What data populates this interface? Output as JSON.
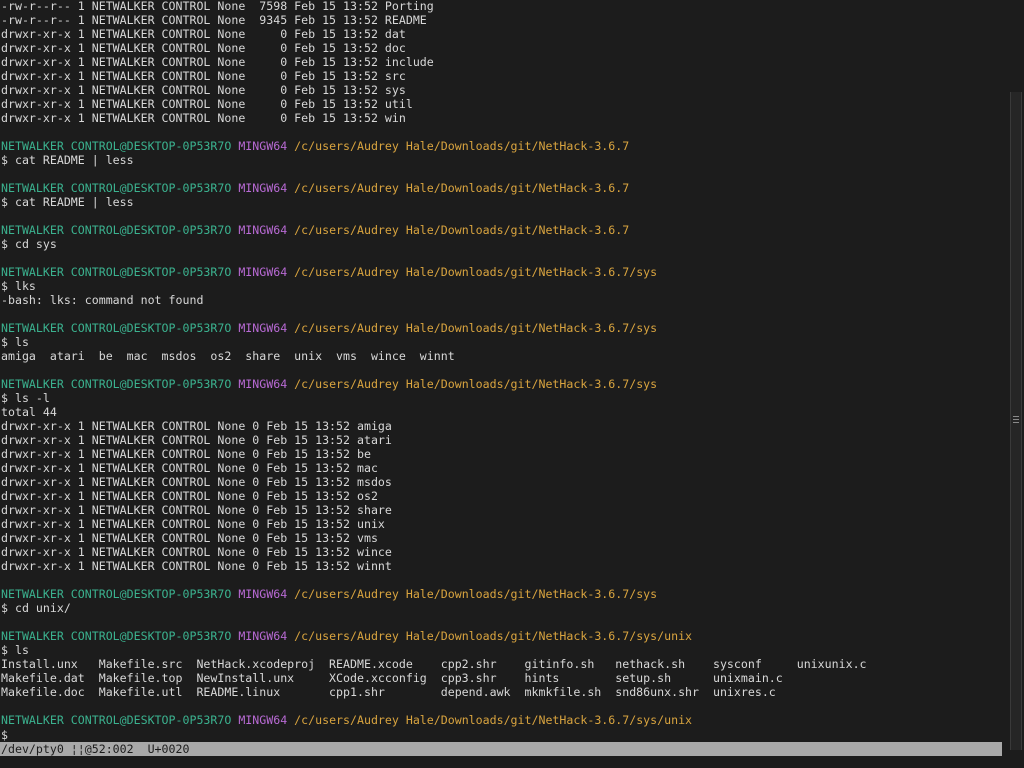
{
  "terminal": {
    "lines": [
      [
        {
          "t": "-rw-r--r-- 1 NETWALKER CONTROL None  7598 Feb 15 13:52 Porting",
          "c": "plain"
        }
      ],
      [
        {
          "t": "-rw-r--r-- 1 NETWALKER CONTROL None  9345 Feb 15 13:52 README",
          "c": "plain"
        }
      ],
      [
        {
          "t": "drwxr-xr-x 1 NETWALKER CONTROL None     0 Feb 15 13:52 dat",
          "c": "plain"
        }
      ],
      [
        {
          "t": "drwxr-xr-x 1 NETWALKER CONTROL None     0 Feb 15 13:52 doc",
          "c": "plain"
        }
      ],
      [
        {
          "t": "drwxr-xr-x 1 NETWALKER CONTROL None     0 Feb 15 13:52 include",
          "c": "plain"
        }
      ],
      [
        {
          "t": "drwxr-xr-x 1 NETWALKER CONTROL None     0 Feb 15 13:52 src",
          "c": "plain"
        }
      ],
      [
        {
          "t": "drwxr-xr-x 1 NETWALKER CONTROL None     0 Feb 15 13:52 sys",
          "c": "plain"
        }
      ],
      [
        {
          "t": "drwxr-xr-x 1 NETWALKER CONTROL None     0 Feb 15 13:52 util",
          "c": "plain"
        }
      ],
      [
        {
          "t": "drwxr-xr-x 1 NETWALKER CONTROL None     0 Feb 15 13:52 win",
          "c": "plain"
        }
      ],
      [],
      [
        {
          "t": "NETWALKER CONTROL@DESKTOP-0P53R7O ",
          "c": "user"
        },
        {
          "t": "MINGW64 ",
          "c": "msys"
        },
        {
          "t": "/c/users/Audrey Hale/Downloads/git/NetHack-3.6.7",
          "c": "path"
        }
      ],
      [
        {
          "t": "$ cat README | less",
          "c": "plain"
        }
      ],
      [],
      [
        {
          "t": "NETWALKER CONTROL@DESKTOP-0P53R7O ",
          "c": "user"
        },
        {
          "t": "MINGW64 ",
          "c": "msys"
        },
        {
          "t": "/c/users/Audrey Hale/Downloads/git/NetHack-3.6.7",
          "c": "path"
        }
      ],
      [
        {
          "t": "$ cat README | less",
          "c": "plain"
        }
      ],
      [],
      [
        {
          "t": "NETWALKER CONTROL@DESKTOP-0P53R7O ",
          "c": "user"
        },
        {
          "t": "MINGW64 ",
          "c": "msys"
        },
        {
          "t": "/c/users/Audrey Hale/Downloads/git/NetHack-3.6.7",
          "c": "path"
        }
      ],
      [
        {
          "t": "$ cd sys",
          "c": "plain"
        }
      ],
      [],
      [
        {
          "t": "NETWALKER CONTROL@DESKTOP-0P53R7O ",
          "c": "user"
        },
        {
          "t": "MINGW64 ",
          "c": "msys"
        },
        {
          "t": "/c/users/Audrey Hale/Downloads/git/NetHack-3.6.7/sys",
          "c": "path"
        }
      ],
      [
        {
          "t": "$ lks",
          "c": "plain"
        }
      ],
      [
        {
          "t": "-bash: lks: command not found",
          "c": "plain"
        }
      ],
      [],
      [
        {
          "t": "NETWALKER CONTROL@DESKTOP-0P53R7O ",
          "c": "user"
        },
        {
          "t": "MINGW64 ",
          "c": "msys"
        },
        {
          "t": "/c/users/Audrey Hale/Downloads/git/NetHack-3.6.7/sys",
          "c": "path"
        }
      ],
      [
        {
          "t": "$ ls",
          "c": "plain"
        }
      ],
      [
        {
          "t": "amiga  atari  be  mac  msdos  os2  share  unix  vms  wince  winnt",
          "c": "plain"
        }
      ],
      [],
      [
        {
          "t": "NETWALKER CONTROL@DESKTOP-0P53R7O ",
          "c": "user"
        },
        {
          "t": "MINGW64 ",
          "c": "msys"
        },
        {
          "t": "/c/users/Audrey Hale/Downloads/git/NetHack-3.6.7/sys",
          "c": "path"
        }
      ],
      [
        {
          "t": "$ ls -l",
          "c": "plain"
        }
      ],
      [
        {
          "t": "total 44",
          "c": "plain"
        }
      ],
      [
        {
          "t": "drwxr-xr-x 1 NETWALKER CONTROL None 0 Feb 15 13:52 amiga",
          "c": "plain"
        }
      ],
      [
        {
          "t": "drwxr-xr-x 1 NETWALKER CONTROL None 0 Feb 15 13:52 atari",
          "c": "plain"
        }
      ],
      [
        {
          "t": "drwxr-xr-x 1 NETWALKER CONTROL None 0 Feb 15 13:52 be",
          "c": "plain"
        }
      ],
      [
        {
          "t": "drwxr-xr-x 1 NETWALKER CONTROL None 0 Feb 15 13:52 mac",
          "c": "plain"
        }
      ],
      [
        {
          "t": "drwxr-xr-x 1 NETWALKER CONTROL None 0 Feb 15 13:52 msdos",
          "c": "plain"
        }
      ],
      [
        {
          "t": "drwxr-xr-x 1 NETWALKER CONTROL None 0 Feb 15 13:52 os2",
          "c": "plain"
        }
      ],
      [
        {
          "t": "drwxr-xr-x 1 NETWALKER CONTROL None 0 Feb 15 13:52 share",
          "c": "plain"
        }
      ],
      [
        {
          "t": "drwxr-xr-x 1 NETWALKER CONTROL None 0 Feb 15 13:52 unix",
          "c": "plain"
        }
      ],
      [
        {
          "t": "drwxr-xr-x 1 NETWALKER CONTROL None 0 Feb 15 13:52 vms",
          "c": "plain"
        }
      ],
      [
        {
          "t": "drwxr-xr-x 1 NETWALKER CONTROL None 0 Feb 15 13:52 wince",
          "c": "plain"
        }
      ],
      [
        {
          "t": "drwxr-xr-x 1 NETWALKER CONTROL None 0 Feb 15 13:52 winnt",
          "c": "plain"
        }
      ],
      [],
      [
        {
          "t": "NETWALKER CONTROL@DESKTOP-0P53R7O ",
          "c": "user"
        },
        {
          "t": "MINGW64 ",
          "c": "msys"
        },
        {
          "t": "/c/users/Audrey Hale/Downloads/git/NetHack-3.6.7/sys",
          "c": "path"
        }
      ],
      [
        {
          "t": "$ cd unix/",
          "c": "plain"
        }
      ],
      [],
      [
        {
          "t": "NETWALKER CONTROL@DESKTOP-0P53R7O ",
          "c": "user"
        },
        {
          "t": "MINGW64 ",
          "c": "msys"
        },
        {
          "t": "/c/users/Audrey Hale/Downloads/git/NetHack-3.6.7/sys/unix",
          "c": "path"
        }
      ],
      [
        {
          "t": "$ ls",
          "c": "plain"
        }
      ],
      [
        {
          "t": "Install.unx   Makefile.src  NetHack.xcodeproj  README.xcode    cpp2.shr    gitinfo.sh   nethack.sh    sysconf     unixunix.c",
          "c": "plain"
        }
      ],
      [
        {
          "t": "Makefile.dat  Makefile.top  NewInstall.unx     XCode.xcconfig  cpp3.shr    hints        setup.sh      unixmain.c",
          "c": "plain"
        }
      ],
      [
        {
          "t": "Makefile.doc  Makefile.utl  README.linux       cpp1.shr        depend.awk  mkmkfile.sh  snd86unx.shr  unixres.c",
          "c": "plain"
        }
      ],
      [],
      [
        {
          "t": "NETWALKER CONTROL@DESKTOP-0P53R7O ",
          "c": "user"
        },
        {
          "t": "MINGW64 ",
          "c": "msys"
        },
        {
          "t": "/c/users/Audrey Hale/Downloads/git/NetHack-3.6.7/sys/unix",
          "c": "path"
        }
      ]
    ],
    "final_prompt": "$"
  },
  "status_bar": {
    "text": "/dev/pty0 ¦¦@52:002  U+0020"
  },
  "colors": {
    "background": "#1c1c1c",
    "text": "#d8d8d8",
    "user_host": "#3bb28f",
    "msystem": "#b86ad4",
    "path": "#d9a43f",
    "status_bar_bg": "#a9a9a9"
  }
}
